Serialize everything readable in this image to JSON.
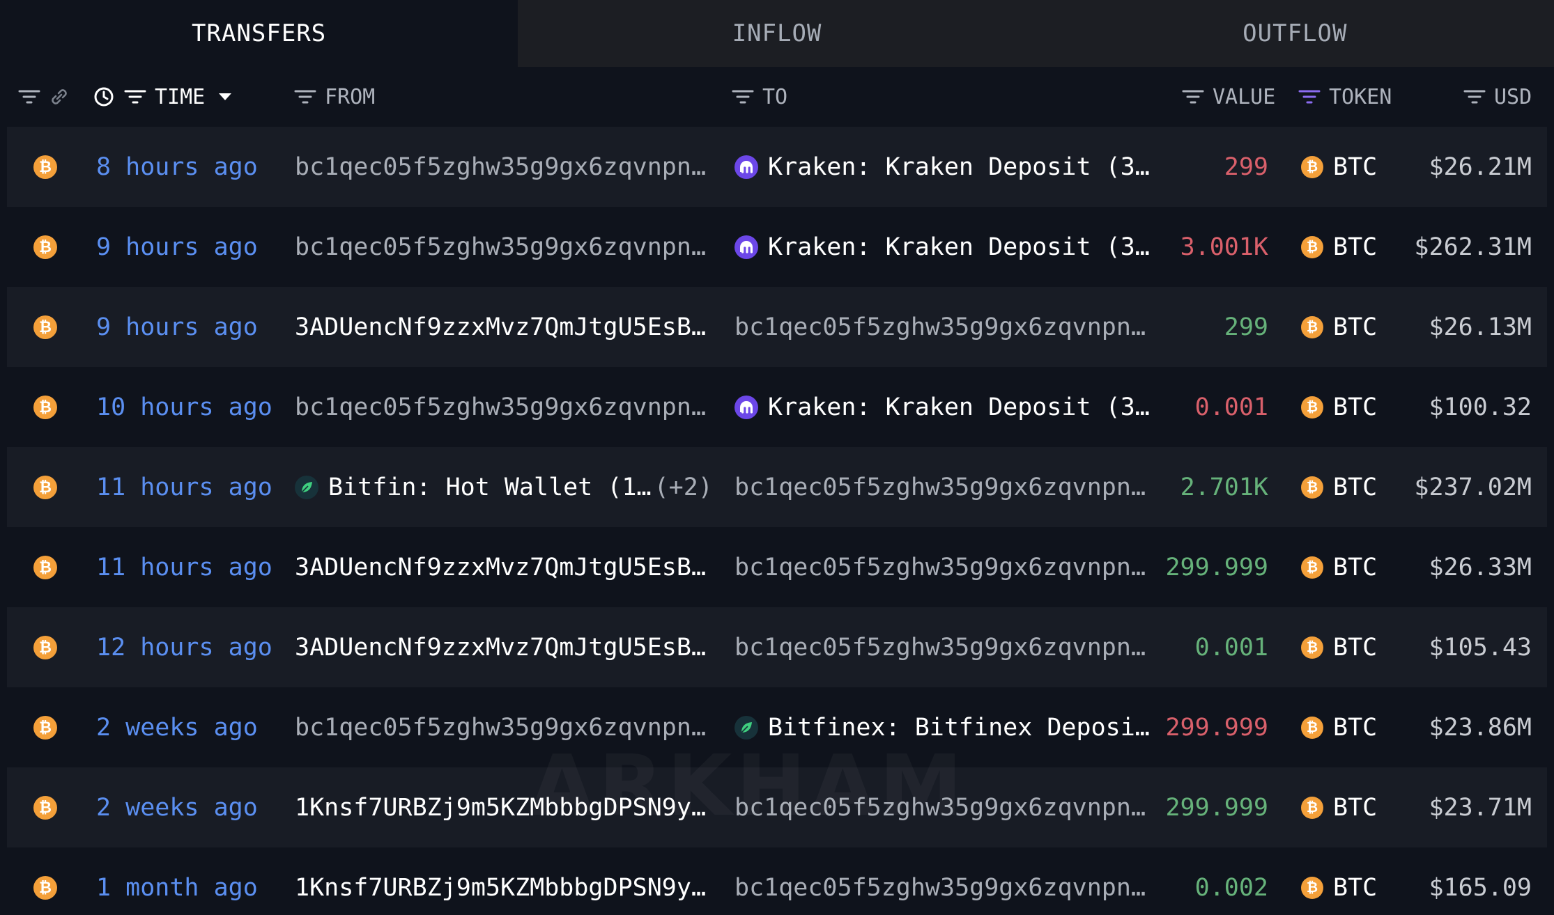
{
  "tabs": [
    {
      "label": "TRANSFERS",
      "active": true
    },
    {
      "label": "INFLOW",
      "active": false
    },
    {
      "label": "OUTFLOW",
      "active": false
    }
  ],
  "columns": {
    "time": "TIME",
    "from": "FROM",
    "to": "TO",
    "value": "VALUE",
    "token": "TOKEN",
    "usd": "USD"
  },
  "colors": {
    "positive": "#66b27a",
    "negative": "#d9606b",
    "time_link": "#5b8ff1",
    "btc": "#f4a03a",
    "kraken": "#6c47e8"
  },
  "rows": [
    {
      "time": "8 hours ago",
      "from": {
        "kind": "address",
        "text": "bc1qec05f5zghw35g9gx6zqvnpn…"
      },
      "to": {
        "kind": "entity",
        "icon": "kraken",
        "text": "Kraken: Kraken Deposit (3…"
      },
      "value": "299",
      "sign": "neg",
      "token": "BTC",
      "usd": "$26.21M"
    },
    {
      "time": "9 hours ago",
      "from": {
        "kind": "address",
        "text": "bc1qec05f5zghw35g9gx6zqvnpn…"
      },
      "to": {
        "kind": "entity",
        "icon": "kraken",
        "text": "Kraken: Kraken Deposit (3…"
      },
      "value": "3.001K",
      "sign": "neg",
      "token": "BTC",
      "usd": "$262.31M"
    },
    {
      "time": "9 hours ago",
      "from": {
        "kind": "address-bright",
        "text": "3ADUencNf9zzxMvz7QmJtgU5EsB…"
      },
      "to": {
        "kind": "address",
        "text": "bc1qec05f5zghw35g9gx6zqvnpn…"
      },
      "value": "299",
      "sign": "pos",
      "token": "BTC",
      "usd": "$26.13M"
    },
    {
      "time": "10 hours ago",
      "from": {
        "kind": "address",
        "text": "bc1qec05f5zghw35g9gx6zqvnpn…"
      },
      "to": {
        "kind": "entity",
        "icon": "kraken",
        "text": "Kraken: Kraken Deposit (3…"
      },
      "value": "0.001",
      "sign": "neg",
      "token": "BTC",
      "usd": "$100.32"
    },
    {
      "time": "11 hours ago",
      "from": {
        "kind": "entity",
        "icon": "bitfinex",
        "text": "Bitfin: Hot Wallet (1…",
        "extra": "(+2)"
      },
      "to": {
        "kind": "address",
        "text": "bc1qec05f5zghw35g9gx6zqvnpn…"
      },
      "value": "2.701K",
      "sign": "pos",
      "token": "BTC",
      "usd": "$237.02M"
    },
    {
      "time": "11 hours ago",
      "from": {
        "kind": "address-bright",
        "text": "3ADUencNf9zzxMvz7QmJtgU5EsB…"
      },
      "to": {
        "kind": "address",
        "text": "bc1qec05f5zghw35g9gx6zqvnpn…"
      },
      "value": "299.999",
      "sign": "pos",
      "token": "BTC",
      "usd": "$26.33M"
    },
    {
      "time": "12 hours ago",
      "from": {
        "kind": "address-bright",
        "text": "3ADUencNf9zzxMvz7QmJtgU5EsB…"
      },
      "to": {
        "kind": "address",
        "text": "bc1qec05f5zghw35g9gx6zqvnpn…"
      },
      "value": "0.001",
      "sign": "pos",
      "token": "BTC",
      "usd": "$105.43"
    },
    {
      "time": "2 weeks ago",
      "from": {
        "kind": "address",
        "text": "bc1qec05f5zghw35g9gx6zqvnpn…"
      },
      "to": {
        "kind": "entity",
        "icon": "bitfinex",
        "text": "Bitfinex: Bitfinex Deposi…"
      },
      "value": "299.999",
      "sign": "neg",
      "token": "BTC",
      "usd": "$23.86M"
    },
    {
      "time": "2 weeks ago",
      "from": {
        "kind": "address-bright",
        "text": "1Knsf7URBZj9m5KZMbbbgDPSN9y…"
      },
      "to": {
        "kind": "address",
        "text": "bc1qec05f5zghw35g9gx6zqvnpn…"
      },
      "value": "299.999",
      "sign": "pos",
      "token": "BTC",
      "usd": "$23.71M"
    },
    {
      "time": "1 month ago",
      "from": {
        "kind": "address-bright",
        "text": "1Knsf7URBZj9m5KZMbbbgDPSN9y…"
      },
      "to": {
        "kind": "address",
        "text": "bc1qec05f5zghw35g9gx6zqvnpn…"
      },
      "value": "0.002",
      "sign": "pos",
      "token": "BTC",
      "usd": "$165.09"
    }
  ],
  "watermark": "ARKHAM"
}
